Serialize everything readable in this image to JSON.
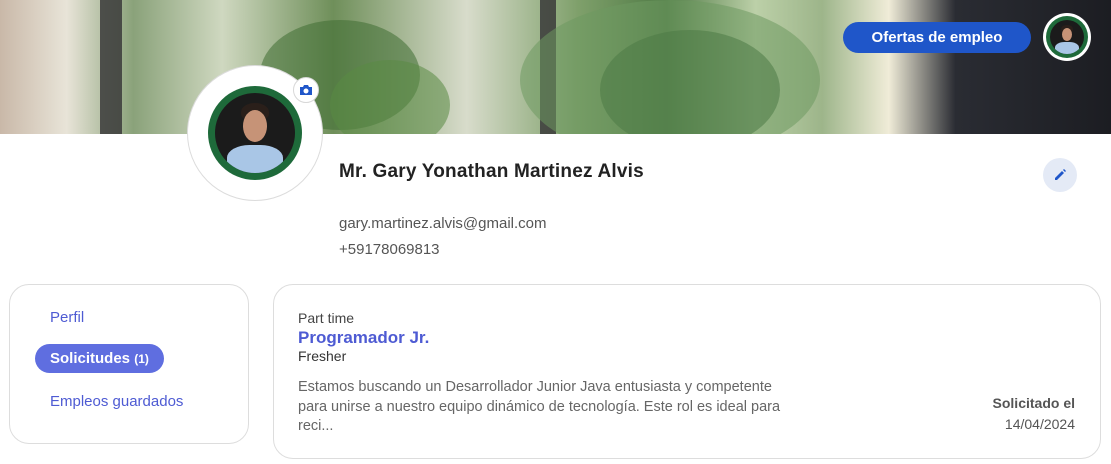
{
  "header": {
    "job_offers_label": "Ofertas de empleo",
    "avatar_icon": "user-avatar-icon"
  },
  "profile": {
    "name": "Mr. Gary Yonathan Martinez Alvis",
    "email": "gary.martinez.alvis@gmail.com",
    "phone": "+59178069813",
    "camera_icon": "camera-icon",
    "edit_icon": "pencil-icon"
  },
  "sidebar": {
    "items": [
      {
        "label": "Perfil",
        "count": "",
        "active": false
      },
      {
        "label": "Solicitudes",
        "count": "(1)",
        "active": true
      },
      {
        "label": "Empleos guardados",
        "count": "",
        "active": false
      }
    ]
  },
  "application": {
    "type": "Part time",
    "title": "Programador Jr.",
    "level": "Fresher",
    "description": "Estamos buscando un Desarrollador Junior Java entusiasta y competente para unirse a nuestro equipo dinámico de tecnología. Este rol es ideal para reci...",
    "applied_label": "Solicitado el",
    "applied_date": "14/04/2024"
  },
  "colors": {
    "primary": "#1f56c9",
    "accent": "#5f6ee0",
    "link": "#4e5bd3"
  }
}
